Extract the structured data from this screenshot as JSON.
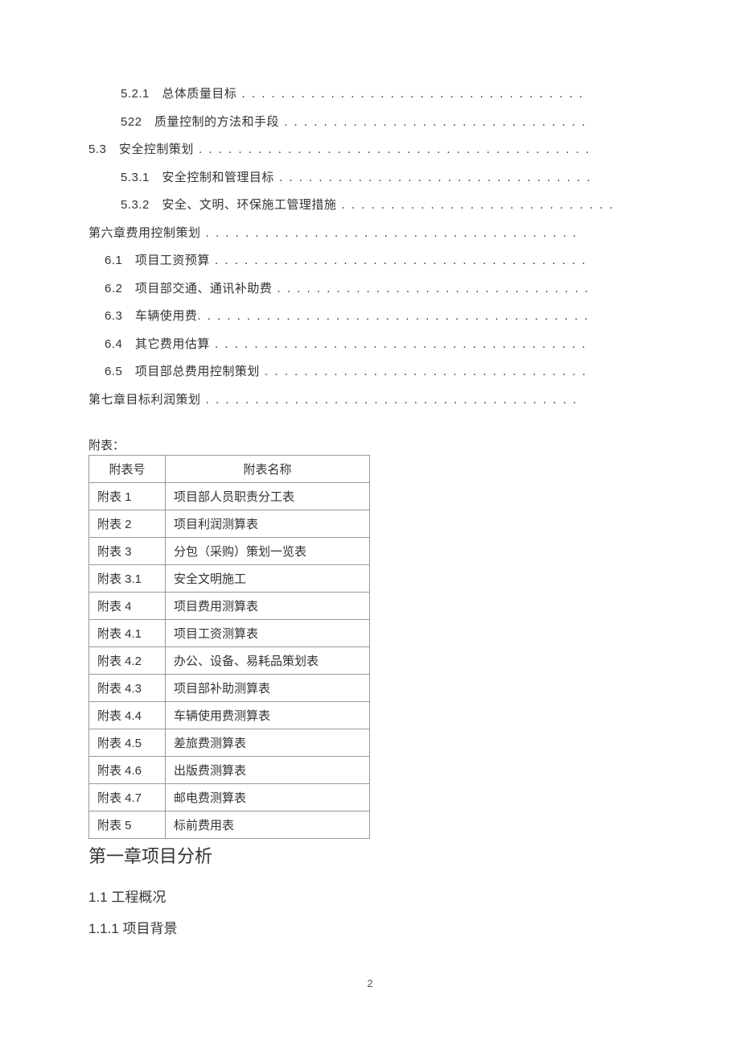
{
  "toc": [
    {
      "indent": "indent-1",
      "num": "5.2.1",
      "title": "总体质量目标",
      "dots": " . . . . . . . . . . . . . . . . . . . . . . . . . . . . . . . . . . ."
    },
    {
      "indent": "indent-1",
      "num": "522",
      "title": "质量控制的方法和手段",
      "dots": " . . . . . . . . . . . . . . . . . . . . . . . . . . . . . . ."
    },
    {
      "indent": "indent-0",
      "num": "5.3",
      "title": "安全控制策划",
      "dots": " . . . . . . . . . . . . . . . . . . . . . . . . . . . . . . . . . . . . . . . ."
    },
    {
      "indent": "indent-1",
      "num": "5.3.1",
      "title": "安全控制和管理目标",
      "dots": " . . . . . . . . . . . . . . . . . . . . . . . . . . . . . . . ."
    },
    {
      "indent": "indent-1",
      "num": "5.3.2",
      "title": "安全、文明、环保施工管理措施",
      "dots": " . . . . . . . . . . . . . . . . . . . . . . . . . . . ."
    },
    {
      "indent": "indent-0",
      "num": "",
      "title": "第六章费用控制策划",
      "dots": " . . . . . . . . . . . . . . . . . . . . . . . . . . . . . . . . . . . . . ."
    },
    {
      "indent": "indent-05",
      "num": "6.1",
      "title": "项目工资预算",
      "dots": " . . . . . . . . . . . . . . . . . . . . . . . . . . . . . . . . . . . . . ."
    },
    {
      "indent": "indent-05",
      "num": "6.2",
      "title": "项目部交通、通讯补助费",
      "dots": " . . . . . . . . . . . . . . . . . . . . . . . . . . . . . . . ."
    },
    {
      "indent": "indent-05",
      "num": "6.3",
      "title": "车辆使用费",
      "dots": ". . . . . . . . . . . . . . . . . . . . . . . . . . . . . . . . . . . . . . . ."
    },
    {
      "indent": "indent-05",
      "num": "6.4",
      "title": "其它费用估算",
      "dots": " . . . . . . . . . . . . . . . . . . . . . . . . . . . . . . . . . . . . . ."
    },
    {
      "indent": "indent-05",
      "num": "6.5",
      "title": "项目部总费用控制策划",
      "dots": " . . . . . . . . . . . . . . . . . . . . . . . . . . . . . . . . ."
    },
    {
      "indent": "indent-0",
      "num": "",
      "title": "第七章目标利润策划",
      "dots": " . . . . . . . . . . . . . . . . . . . . . . . . . . . . . . . . . . . . . ."
    }
  ],
  "attach_label": "附表：",
  "attach_headers": [
    "附表号",
    "附表名称"
  ],
  "attach_rows": [
    [
      "附表 1",
      "项目部人员职责分工表"
    ],
    [
      "附表 2",
      "项目利润测算表"
    ],
    [
      "附表 3",
      "分包（采购）策划一览表"
    ],
    [
      "附表 3.1",
      "安全文明施工"
    ],
    [
      "附表 4",
      "项目费用测算表"
    ],
    [
      "附表 4.1",
      "项目工资测算表"
    ],
    [
      "附表 4.2",
      "办公、设备、易耗品策划表"
    ],
    [
      "附表 4.3",
      "项目部补助测算表"
    ],
    [
      "附表 4.4",
      "车辆使用费测算表"
    ],
    [
      "附表 4.5",
      "差旅费测算表"
    ],
    [
      "附表 4.6",
      "出版费测算表"
    ],
    [
      "附表 4.7",
      "邮电费测算表"
    ],
    [
      "附表 5",
      "标前费用表"
    ]
  ],
  "headings": {
    "h1": "第一章项目分析",
    "h2": "1.1 工程概况",
    "h3": "1.1.1 项目背景"
  },
  "page_number": "2"
}
